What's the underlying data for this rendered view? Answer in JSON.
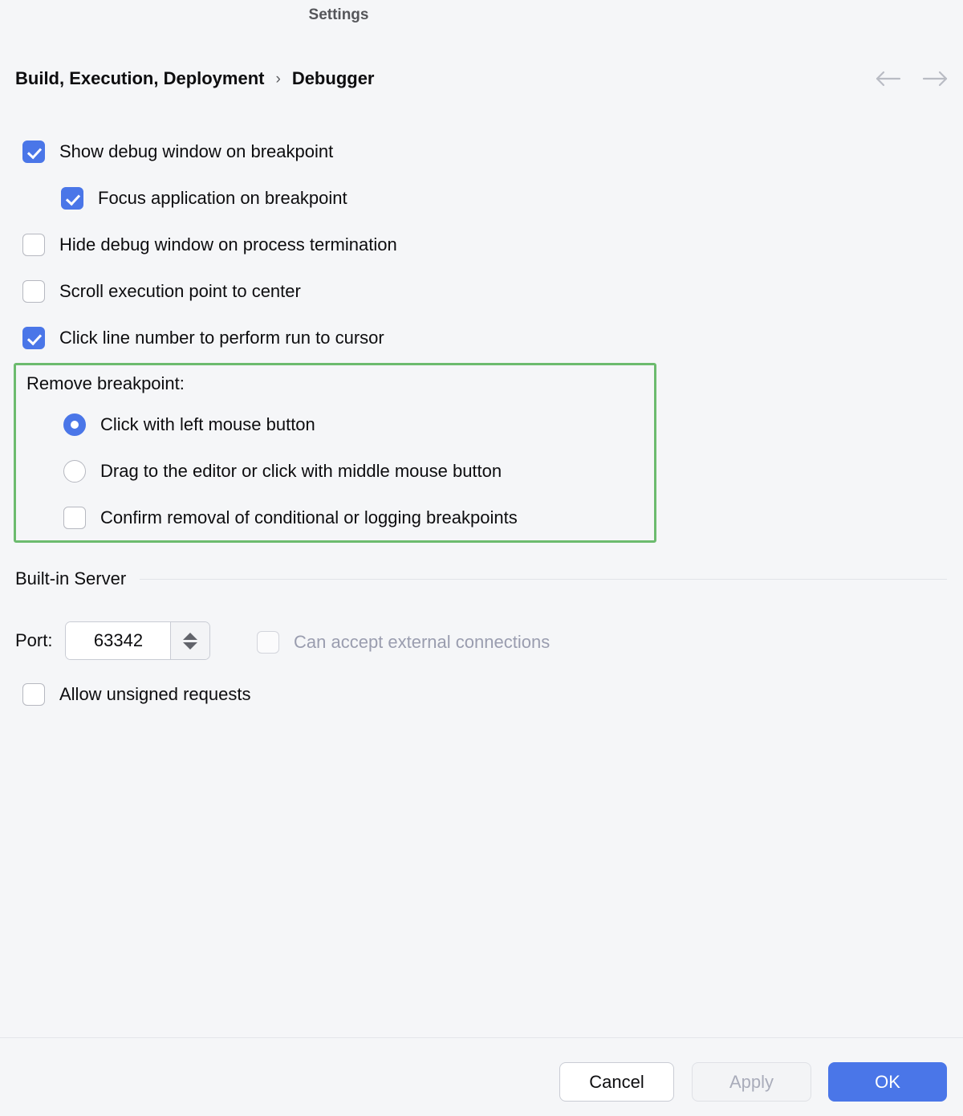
{
  "window": {
    "title": "Settings"
  },
  "breadcrumb": {
    "root": "Build, Execution, Deployment",
    "separator": "›",
    "leaf": "Debugger",
    "back_icon": "arrow-left-icon",
    "forward_icon": "arrow-right-icon"
  },
  "options": [
    {
      "label": "Show debug window on breakpoint",
      "checked": true,
      "indent": false
    },
    {
      "label": "Focus application on breakpoint",
      "checked": true,
      "indent": true
    },
    {
      "label": "Hide debug window on process termination",
      "checked": false,
      "indent": false
    },
    {
      "label": "Scroll execution point to center",
      "checked": false,
      "indent": false
    },
    {
      "label": "Click line number to perform run to cursor",
      "checked": true,
      "indent": false
    }
  ],
  "remove_breakpoint": {
    "caption": "Remove breakpoint:",
    "highlight_color": "#6cbb6e",
    "radios": [
      {
        "label": "Click with left mouse button",
        "selected": true
      },
      {
        "label": "Drag to the editor or click with middle mouse button",
        "selected": false
      }
    ],
    "checkbox": {
      "label": "Confirm removal of conditional or logging breakpoints",
      "checked": false
    }
  },
  "builtin_server": {
    "title": "Built-in Server",
    "port_label": "Port:",
    "port_value": "63342",
    "spinner_up_icon": "triangle-up-icon",
    "spinner_down_icon": "triangle-down-icon",
    "external_connections": {
      "label": "Can accept external connections",
      "checked": false,
      "disabled": true
    },
    "allow_unsigned": {
      "label": "Allow unsigned requests",
      "checked": false
    }
  },
  "footer": {
    "cancel": "Cancel",
    "apply": "Apply",
    "ok": "OK",
    "accent_color": "#4a76e8"
  }
}
